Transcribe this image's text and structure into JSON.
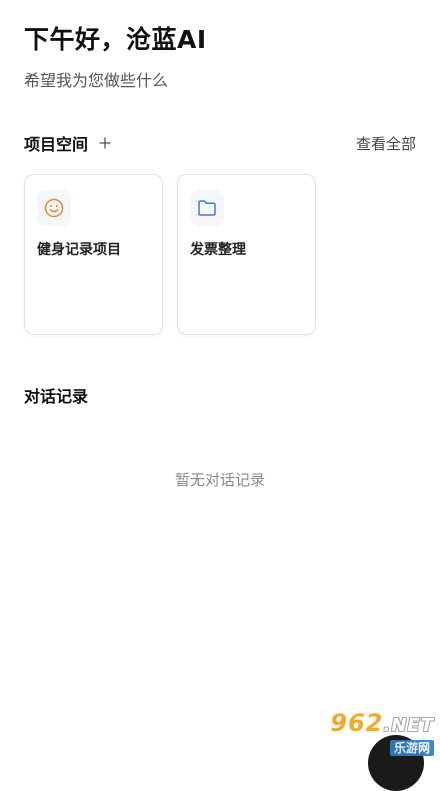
{
  "header": {
    "greeting": "下午好，沧蓝AI",
    "subtitle": "希望我为您做些什么"
  },
  "projects": {
    "title": "项目空间",
    "add_label": "+",
    "view_all": "查看全部",
    "items": [
      {
        "label": "健身记录项目",
        "icon": "smile-icon",
        "icon_color": "#e08a2e"
      },
      {
        "label": "发票整理",
        "icon": "folder-icon",
        "icon_color": "#3f7bd0"
      }
    ]
  },
  "history": {
    "title": "对话记录",
    "empty_text": "暂无对话记录"
  },
  "watermark": {
    "top": "962",
    "net": ".NET",
    "bottom": "乐游网"
  }
}
